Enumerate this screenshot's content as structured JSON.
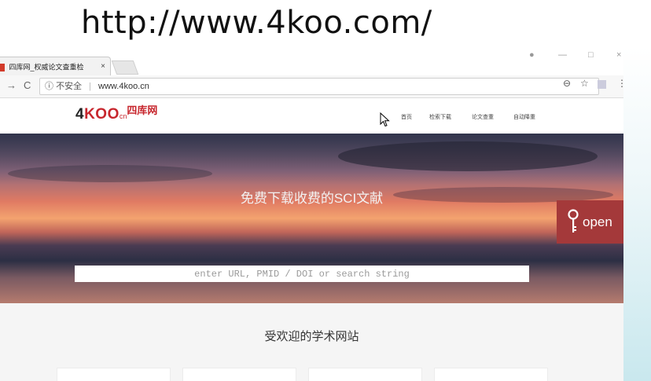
{
  "caption_url": "http://www.4koo.com/",
  "browser": {
    "tab_title": "四库网_权威论文查重检",
    "tab_close": "×",
    "address": {
      "security_label": "不安全",
      "url": "www.4koo.cn"
    }
  },
  "site": {
    "logo": {
      "number": "4",
      "brand": "KOO",
      "cn_suffix": "cn",
      "chinese_name": "四库网"
    },
    "nav": [
      "首页",
      "检索下载",
      "论文查重",
      "自动降重"
    ],
    "hero": {
      "title": "免费下载收费的SCI文献",
      "search_placeholder": "enter URL, PMID / DOI or search string",
      "open_button": "open"
    },
    "popular_title": "受欢迎的学术网站"
  },
  "colors": {
    "brand_red": "#c7262d",
    "open_button": "#a4393a"
  }
}
